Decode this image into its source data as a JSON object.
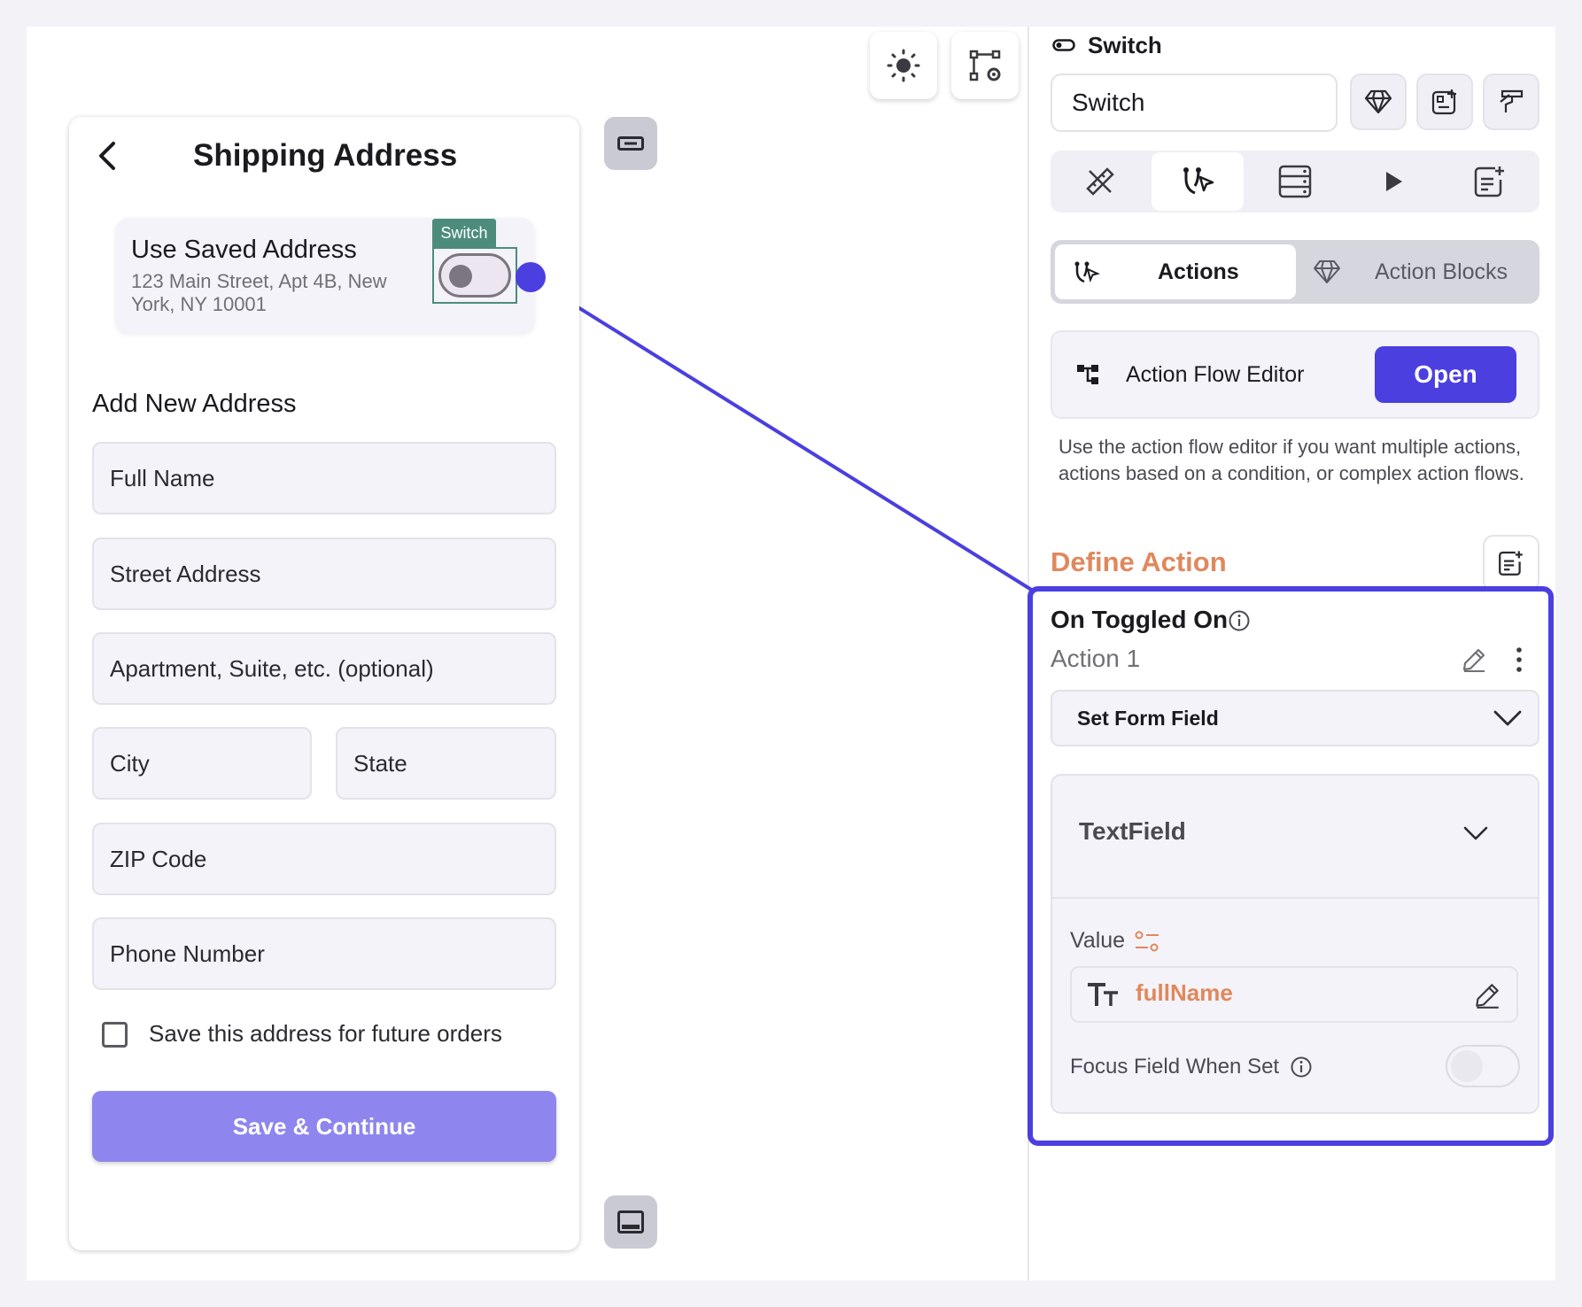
{
  "canvas": {
    "theme_icon": "sun-icon",
    "tree_settings_icon": "widget-tree-settings-icon"
  },
  "phone": {
    "title": "Shipping Address",
    "saved_address": {
      "title": "Use Saved Address",
      "address": "123 Main Street, Apt 4B, New York, NY 10001",
      "switch_tag": "Switch",
      "switch_on": false
    },
    "section_title": "Add New Address",
    "fields": {
      "full_name": "Full Name",
      "street": "Street Address",
      "apartment": "Apartment, Suite, etc. (optional)",
      "city": "City",
      "state": "State",
      "zip": "ZIP Code",
      "phone": "Phone Number"
    },
    "save_checkbox_label": "Save this address for future orders",
    "save_button": "Save & Continue"
  },
  "panel": {
    "header": "Switch",
    "widget_name": "Switch",
    "tabs": [
      {
        "icon": "properties-ruler-icon",
        "active": false
      },
      {
        "icon": "actions-icon",
        "active": true
      },
      {
        "icon": "backend-query-icon",
        "active": false
      },
      {
        "icon": "animation-play-icon",
        "active": false
      },
      {
        "icon": "documentation-icon",
        "active": false
      }
    ],
    "segment": {
      "actions": "Actions",
      "action_blocks": "Action Blocks"
    },
    "action_flow_editor": {
      "label": "Action Flow Editor",
      "button": "Open",
      "help": "Use the action flow editor if you want multiple actions, actions based on a condition, or complex action flows."
    },
    "define_action": "Define Action",
    "trigger": "On Toggled On",
    "action_name": "Action 1",
    "action_type": "Set Form Field",
    "target_field": "TextField",
    "value_label": "Value",
    "value": "fullName",
    "focus_label": "Focus Field When Set",
    "focus_on": false
  },
  "colors": {
    "accent": "#4b3fe0",
    "orange": "#e0885c",
    "switch_tag": "#4d8c7d",
    "save_button": "#8e86ee"
  }
}
